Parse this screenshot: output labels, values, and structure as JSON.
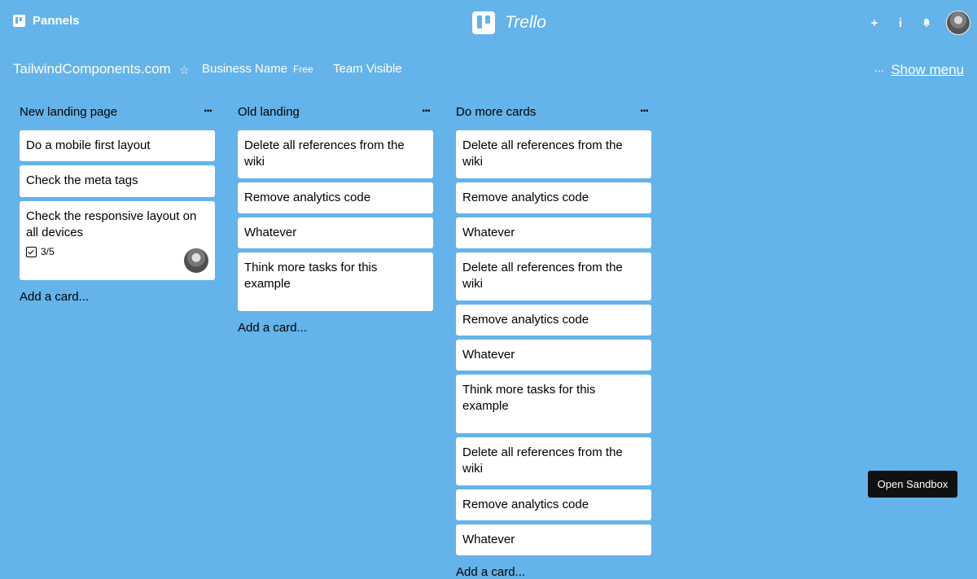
{
  "brand": {
    "label": "Pannels"
  },
  "logo": {
    "text": "Trello"
  },
  "top_actions": {
    "add": "+",
    "info": "i"
  },
  "board": {
    "title": "TailwindComponents.com",
    "star": "☆",
    "business": "Business Name",
    "plan": "Free",
    "visibility": "Team Visible",
    "menu_dots": "···",
    "menu_label": "Show menu"
  },
  "lists": [
    {
      "title": "New landing page",
      "more": "···",
      "cards": [
        {
          "text": "Do a mobile first layout"
        },
        {
          "text": "Check the meta tags"
        },
        {
          "text": "Check the responsive layout on all devices",
          "checklist": "3/5"
        }
      ],
      "add": "Add a card..."
    },
    {
      "title": "Old landing",
      "more": "···",
      "cards": [
        {
          "text": "Delete all references from the wiki"
        },
        {
          "text": "Remove analytics code"
        },
        {
          "text": "Whatever"
        },
        {
          "text": "Think more tasks for this example"
        }
      ],
      "add": "Add a card..."
    },
    {
      "title": "Do more cards",
      "more": "···",
      "cards": [
        {
          "text": "Delete all references from the wiki"
        },
        {
          "text": "Remove analytics code"
        },
        {
          "text": "Whatever"
        },
        {
          "text": "Delete all references from the wiki"
        },
        {
          "text": "Remove analytics code"
        },
        {
          "text": "Whatever"
        },
        {
          "text": "Think more tasks for this example"
        },
        {
          "text": "Delete all references from the wiki"
        },
        {
          "text": "Remove analytics code"
        },
        {
          "text": "Whatever"
        }
      ],
      "add": "Add a card..."
    }
  ],
  "sandbox": {
    "label": "Open Sandbox"
  },
  "colors": {
    "background": "#64b3ea",
    "card": "#ffffff",
    "sandbox": "#111111"
  }
}
